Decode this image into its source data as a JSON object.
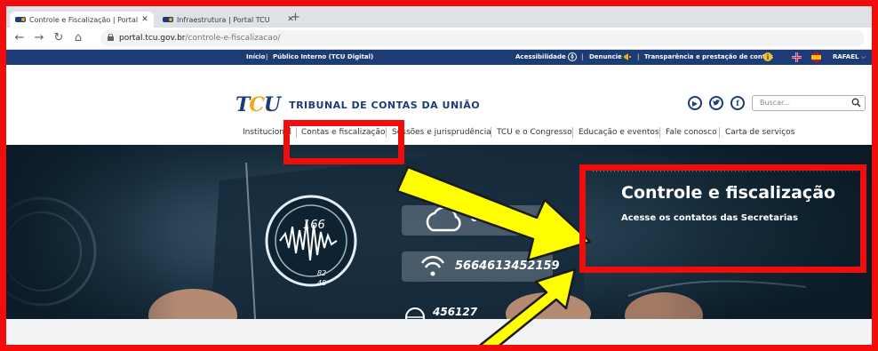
{
  "browser": {
    "tabs": [
      {
        "title": "Controle e Fiscalização | Portal TCU",
        "active": true,
        "close": "✕"
      },
      {
        "title": "Infraestrutura | Portal TCU",
        "active": false,
        "close": "✕"
      }
    ],
    "new_tab": "+",
    "url_host": "portal.tcu.gov.br",
    "url_path": "/controle-e-fiscalizacao/"
  },
  "topbar": {
    "inicio": "Início",
    "publico_interno": "Público Interno (TCU Digital)",
    "acessibilidade": "Acessibilidade",
    "denuncie": "Denuncie",
    "transparencia": "Transparência e prestação de contas",
    "user": "RAFAEL"
  },
  "header": {
    "logo_left": "T",
    "logo_mid": "C",
    "logo_right": "U",
    "org_name": "TRIBUNAL DE CONTAS DA UNIÃO",
    "search_placeholder": "Buscar..."
  },
  "menu": {
    "items": [
      "Institucional",
      "Contas e fiscalização",
      "Sessões e jurisprudência",
      "TCU e o Congresso",
      "Educação e eventos",
      "Fale conosco",
      "Carta de serviços"
    ]
  },
  "hero": {
    "title": "Controle e fiscalização",
    "subtitle": "Acesse os contatos das Secretarias",
    "dial_top": "166",
    "dial_bottom_1": "82",
    "dial_bottom_2": "48",
    "num_1": "0216546",
    "num_2": "5664613452159",
    "num_3": "456127"
  },
  "colors": {
    "annotation_red": "#f20d0d",
    "annotation_yellow": "#ffff00",
    "tcu_blue": "#1d3b74",
    "tcu_gold": "#f0a81c"
  }
}
